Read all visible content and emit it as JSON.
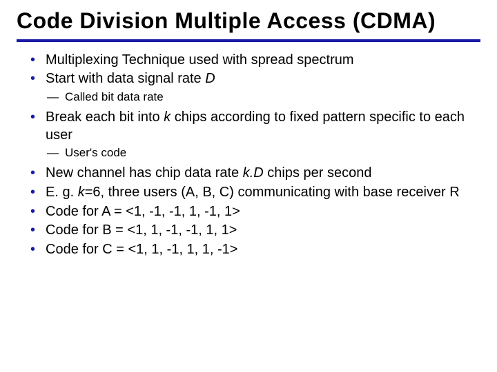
{
  "title": "Code Division Multiple Access (CDMA)",
  "b1_pre": "Multiplexing Technique used with spread spectrum",
  "b2_pre": "Start with data signal rate ",
  "b2_ital": "D",
  "b2_sub1": "Called bit data rate",
  "b3_pre": "Break each bit into ",
  "b3_k": "k",
  "b3_post": " chips according to fixed pattern specific to each user",
  "b3_sub1": "User's code",
  "b4_pre": "New channel has chip data rate ",
  "b4_kd": "k.D",
  "b4_post": " chips per second",
  "b5_pre": "E. g. ",
  "b5_k": "k",
  "b5_post": "=6, three users (A, B, C) communicating with base receiver R",
  "b6": "Code for A = <1, -1, -1, 1, -1, 1>",
  "b7": "Code for B = <1, 1, -1, -1, 1, 1>",
  "b8": "Code for C = <1, 1, -1, 1, 1, -1>"
}
